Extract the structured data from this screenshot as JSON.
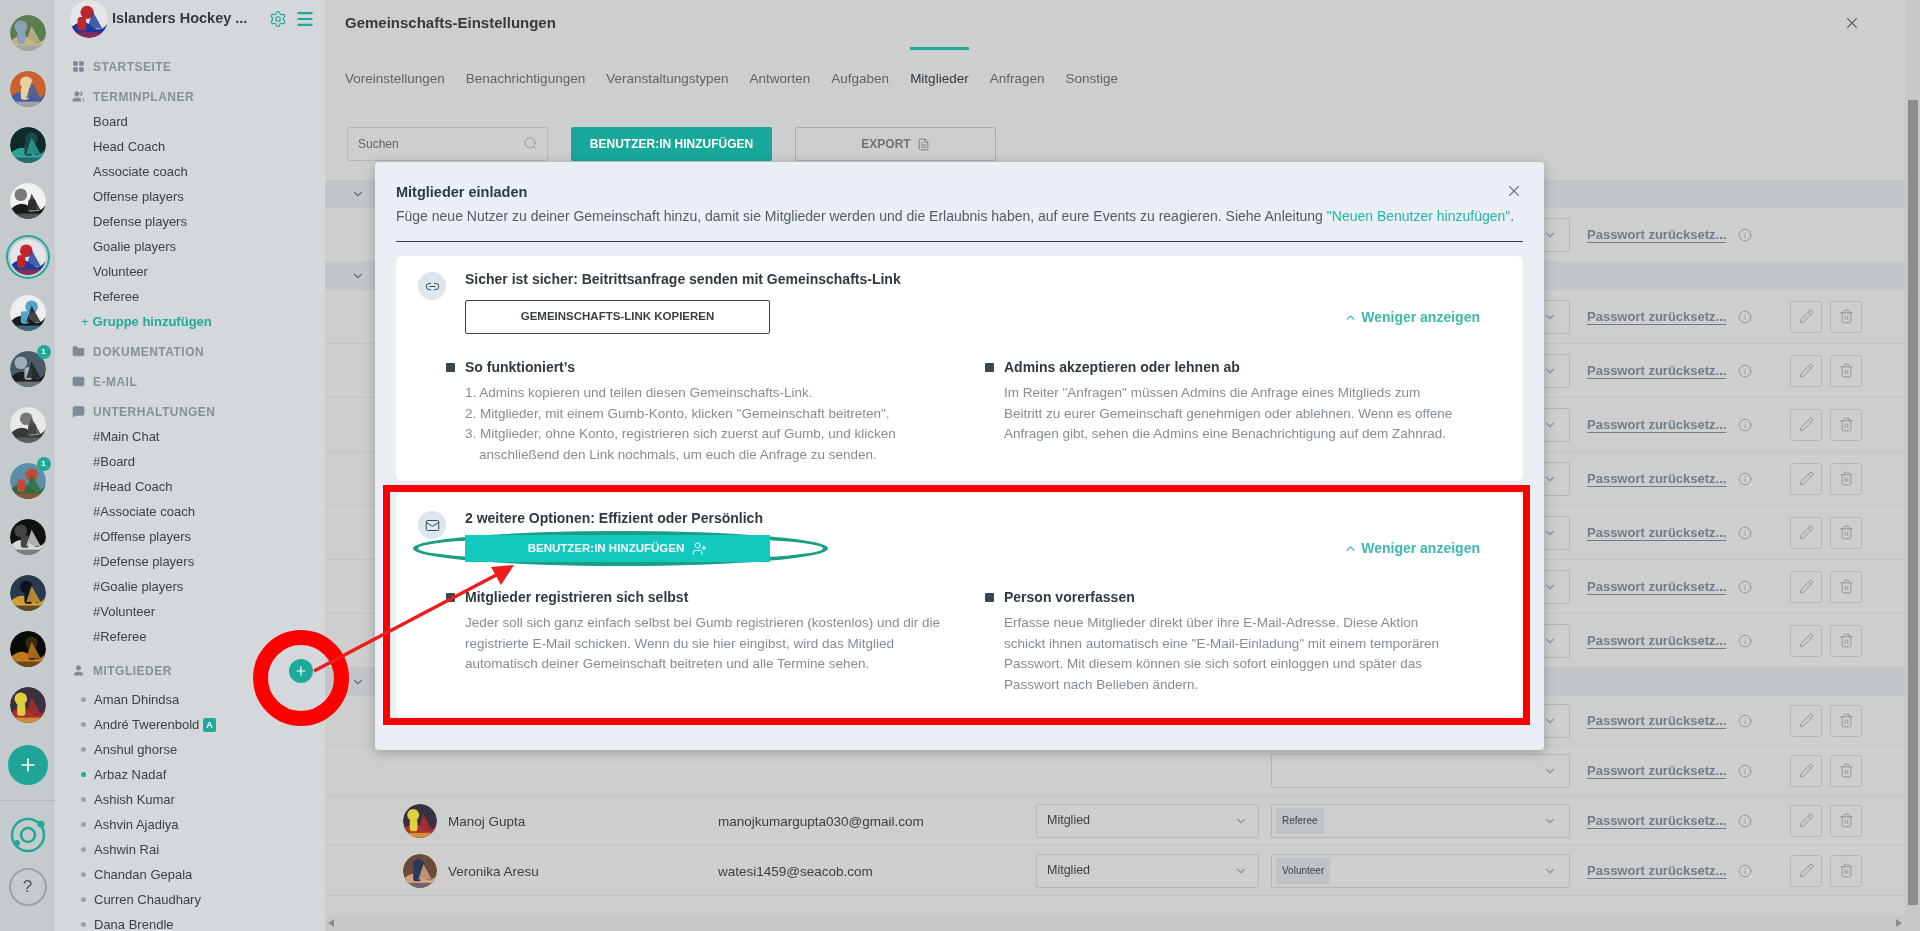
{
  "rail": {
    "avatars": [
      {
        "kind": "picture",
        "selected": false
      },
      {
        "kind": "picture",
        "selected": false
      },
      {
        "kind": "picture",
        "selected": false
      },
      {
        "kind": "picture",
        "selected": false
      },
      {
        "kind": "picture",
        "selected": true
      },
      {
        "kind": "picture",
        "selected": false
      },
      {
        "kind": "picture",
        "selected": false,
        "badge": "1"
      },
      {
        "kind": "picture",
        "selected": false
      },
      {
        "kind": "picture",
        "selected": false,
        "badge": "1"
      },
      {
        "kind": "picture",
        "selected": false
      },
      {
        "kind": "picture",
        "selected": false
      },
      {
        "kind": "picture",
        "selected": false
      },
      {
        "kind": "picture",
        "selected": false
      }
    ],
    "help": "?"
  },
  "sidebar": {
    "title": "Islanders Hockey ...",
    "sections": [
      {
        "label": "STARTSEITE"
      },
      {
        "label": "TERMINPLANER",
        "items": [
          "Board",
          "Head Coach",
          "Associate coach",
          "Offense players",
          "Defense players",
          "Goalie players",
          "Volunteer",
          "Referee"
        ],
        "add_link": {
          "icon": "+",
          "label": "Gruppe hinzufügen"
        }
      },
      {
        "label": "DOKUMENTATION"
      },
      {
        "label": "E-MAIL"
      },
      {
        "label": "UNTERHALTUNGEN",
        "items": [
          "#Main Chat",
          "#Board",
          "#Head Coach",
          "#Associate coach",
          "#Offense players",
          "#Defense players",
          "#Goalie players",
          "#Volunteer",
          "#Referee"
        ]
      },
      {
        "label": "MITGLIEDER",
        "add_button": true,
        "members": [
          {
            "name": "Aman Dhindsa",
            "online": false
          },
          {
            "name": "André Twerenbold",
            "online": false,
            "badge": "A"
          },
          {
            "name": "Anshul ghorse",
            "online": false
          },
          {
            "name": "Arbaz Nadaf",
            "online": true
          },
          {
            "name": "Ashish Kumar",
            "online": false
          },
          {
            "name": "Ashvin Ajadiya",
            "online": false
          },
          {
            "name": "Ashwin Rai",
            "online": false
          },
          {
            "name": "Chandan Gepala",
            "online": false
          },
          {
            "name": "Curren Chaudhary",
            "online": false
          },
          {
            "name": "Dana Brendle",
            "online": false
          }
        ]
      }
    ]
  },
  "main": {
    "title": "Gemeinschafts-Einstellungen",
    "tabs": [
      {
        "label": "Voreinstellungen",
        "selected": false
      },
      {
        "label": "Benachrichtigungen",
        "selected": false
      },
      {
        "label": "Veranstaltungstypen",
        "selected": false
      },
      {
        "label": "Antworten",
        "selected": false
      },
      {
        "label": "Aufgaben",
        "selected": false
      },
      {
        "label": "Mitglieder",
        "selected": true
      },
      {
        "label": "Anfragen",
        "selected": false
      },
      {
        "label": "Sonstige",
        "selected": false
      }
    ],
    "search": {
      "placeholder": "Suchen"
    },
    "add_button": "BENUTZER:IN HINZUFÜGEN",
    "export_button": "EXPORT",
    "table": {
      "sections": [
        {
          "rows": [
            {
              "password_link": "Passwort zurücksetz...",
              "actions": false
            }
          ]
        },
        {
          "rows": [
            {
              "password_link": "Passwort zurücksetz...",
              "actions": true
            },
            {
              "password_link": "Passwort zurücksetz...",
              "actions": true
            },
            {
              "password_link": "Passwort zurücksetz...",
              "actions": true
            },
            {
              "password_link": "Passwort zurücksetz...",
              "actions": true
            },
            {
              "password_link": "Passwort zurücksetz...",
              "actions": true
            },
            {
              "password_link": "Passwort zurücksetz...",
              "actions": true
            },
            {
              "password_link": "Passwort zurücksetz...",
              "actions": true
            }
          ]
        },
        {
          "rows": [
            {
              "password_link": "Passwort zurücksetz...",
              "actions": true
            },
            {
              "password_link": "Passwort zurücksetz...",
              "actions": true
            },
            {
              "photo": {
                "kind": "picture"
              },
              "name": "Manoj Gupta",
              "email": "manojkumargupta030@gmail.com",
              "role": "Mitglied",
              "group": "Referee",
              "password_link": "Passwort zurücksetz...",
              "actions": true
            },
            {
              "photo": {
                "kind": "picture"
              },
              "name": "Veronika Aresu",
              "email": "watesi1459@seacob.com",
              "role": "Mitglied",
              "group": "Volunteer",
              "password_link": "Passwort zurücksetz...",
              "actions": true
            }
          ]
        }
      ]
    }
  },
  "modal": {
    "title": "Mitglieder einladen",
    "description": "Füge neue Nutzer zu deiner Gemeinschaft hinzu, damit sie Mitglieder werden und die Erlaubnis haben, auf eure Events zu reagieren. Siehe Anleitung",
    "guide_link": "\"Neuen Benutzer hinzufügen\"",
    "description_end": ".",
    "cards": [
      {
        "kind": "link",
        "title": "Sicher ist sicher: Beitrittsanfrage senden mit Gemeinschafts-Link",
        "button": "GEMEINSCHAFTS-LINK KOPIEREN",
        "toggle": "Weniger anzeigen",
        "expanded": true,
        "highlighted": false,
        "button_circled": false,
        "columns": [
          {
            "title": "So funktioniert’s",
            "steps": [
              "1. Admins kopieren und teilen diesen Gemeinschafts-Link.",
              "2. Mitglieder, mit einem Gumb-Konto, klicken \"Gemeinschaft beitreten\".",
              "3. Mitglieder, ohne Konto, registrieren sich zuerst auf Gumb, und klicken anschließend den Link nochmals, um euch die Anfrage zu senden."
            ]
          },
          {
            "title": "Admins akzeptieren oder lehnen ab",
            "text": "Im Reiter \"Anfragen\" müssen Admins die Anfrage eines Mitglieds zum Beitritt zu eurer Gemeinschaft genehmigen oder ablehnen. Wenn es offene Anfragen gibt, sehen die Admins eine Benachrichtigung auf dem Zahnrad."
          }
        ]
      },
      {
        "kind": "invite",
        "title": "2 weitere Optionen: Effizient oder Persönlich",
        "button": "BENUTZER:IN HINZUFÜGEN",
        "toggle": "Weniger anzeigen",
        "expanded": true,
        "highlighted": true,
        "button_circled": true,
        "columns": [
          {
            "title": "Mitglieder registrieren sich selbst",
            "text": "Jeder soll sich ganz einfach selbst bei Gumb registrieren (kostenlos) und dir die registrierte E-Mail schicken. Wenn du sie hier eingibst, wird das Mitglied automatisch deiner Gemeinschaft beitreten und alle Termine sehen."
          },
          {
            "title": "Person vorerfassen",
            "text": "Erfasse neue Mitglieder direkt über ihre E-Mail-Adresse. Diese Aktion schickt ihnen automatisch eine \"E-Mail-Einladung\" mit einem temporären Passwort. Mit diesem können sie sich sofort einloggen und später das Passwort nach Belieben ändern."
          }
        ]
      }
    ]
  },
  "annotations": {
    "ring_on_add_member": true,
    "arrow": true
  }
}
